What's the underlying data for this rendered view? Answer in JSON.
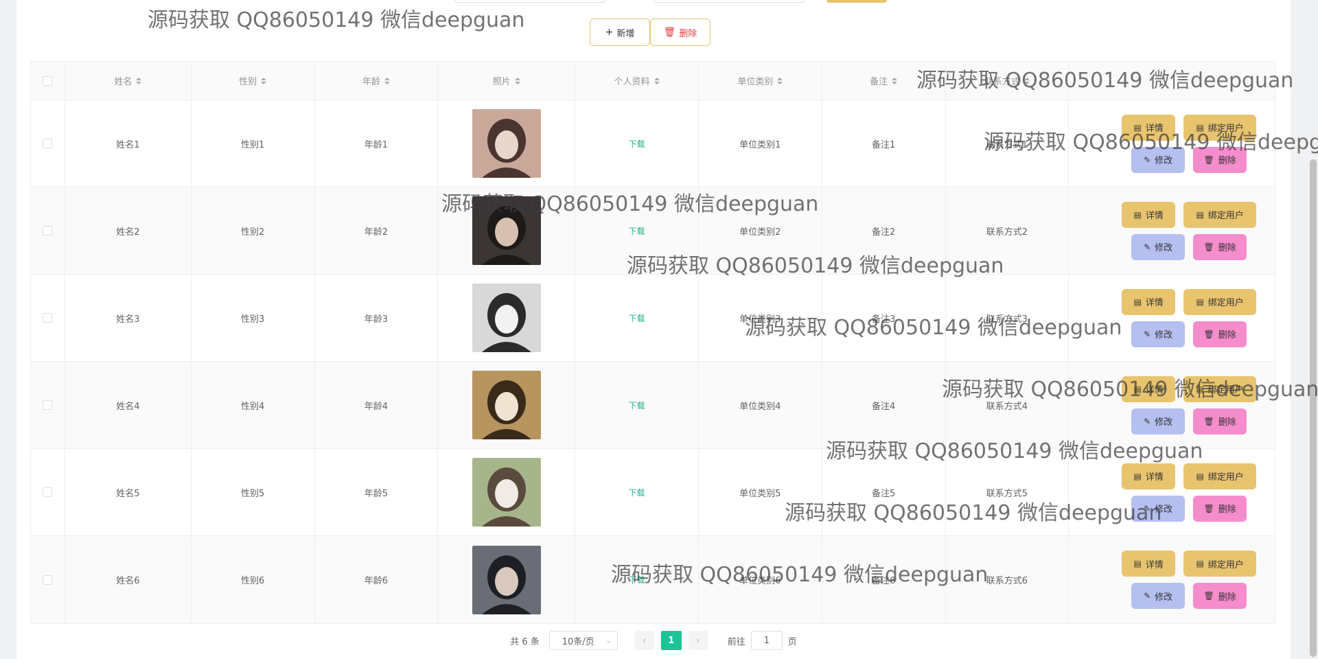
{
  "toolbar": {
    "add_label": "新增",
    "delete_label": "删除"
  },
  "table": {
    "headers": [
      "姓名",
      "性别",
      "年龄",
      "照片",
      "个人资料",
      "单位类别",
      "备注",
      "联系方式"
    ],
    "rows": [
      {
        "name": "姓名1",
        "gender": "性别1",
        "age": "年龄1",
        "file": "下载",
        "unit": "单位类别1",
        "remark": "备注1",
        "contact": "联系方式1"
      },
      {
        "name": "姓名2",
        "gender": "性别2",
        "age": "年龄2",
        "file": "下载",
        "unit": "单位类别2",
        "remark": "备注2",
        "contact": "联系方式2"
      },
      {
        "name": "姓名3",
        "gender": "性别3",
        "age": "年龄3",
        "file": "下载",
        "unit": "单位类别3",
        "remark": "备注3",
        "contact": "联系方式3"
      },
      {
        "name": "姓名4",
        "gender": "性别4",
        "age": "年龄4",
        "file": "下载",
        "unit": "单位类别4",
        "remark": "备注4",
        "contact": "联系方式4"
      },
      {
        "name": "姓名5",
        "gender": "性别5",
        "age": "年龄5",
        "file": "下载",
        "unit": "单位类别5",
        "remark": "备注5",
        "contact": "联系方式5"
      },
      {
        "name": "姓名6",
        "gender": "性别6",
        "age": "年龄6",
        "file": "下载",
        "unit": "单位类别6",
        "remark": "备注6",
        "contact": "联系方式6"
      }
    ],
    "actions": {
      "detail": "详情",
      "bind": "绑定用户",
      "edit": "修改",
      "delete": "删除"
    }
  },
  "pagination": {
    "total": "共 6 条",
    "page_size": "10条/页",
    "current_page": "1",
    "goto_prefix": "前往",
    "goto_value": "1",
    "goto_suffix": "页"
  },
  "watermark": "源码获取 QQ86050149 微信deepguan",
  "colors": {
    "accent": "#1ec398",
    "button_yellow": "#e8c46e",
    "button_blue": "#b5bff0",
    "button_pink": "#f58ccc",
    "link_green": "#1eb28a"
  },
  "icons": {
    "add": "plus-icon",
    "delete": "trash-icon",
    "detail": "document-icon",
    "edit": "pencil-icon",
    "sort": "sort-caret-icon"
  }
}
